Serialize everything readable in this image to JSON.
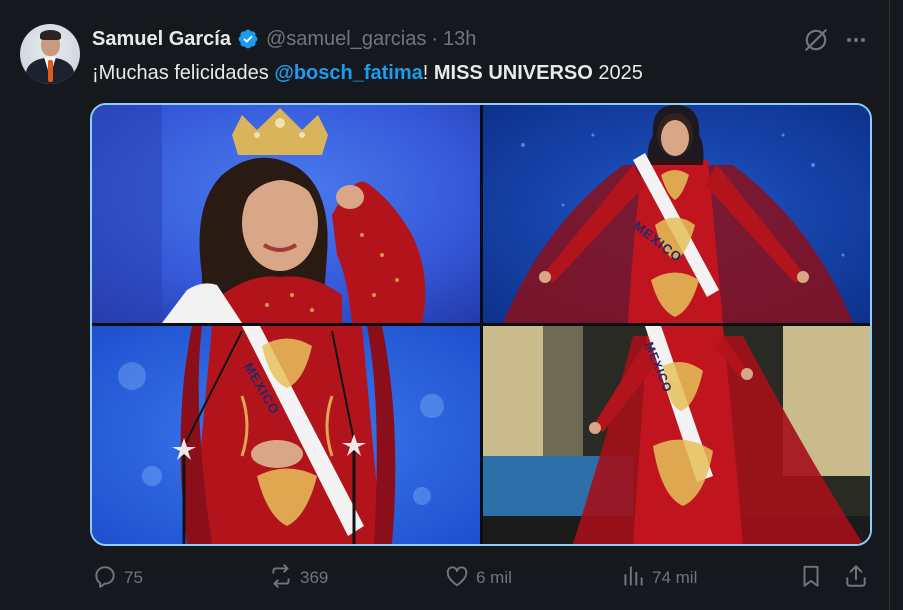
{
  "tweet": {
    "author_name": "Samuel García",
    "handle": "@samuel_garcias",
    "separator": "·",
    "time": "13h",
    "text_prefix": "¡Muchas felicidades ",
    "mention": "@bosch_fatima",
    "text_after_mention": "! ",
    "text_bold": "MISS UNIVERSO",
    "text_suffix": " 2025"
  },
  "media": {
    "sash_text": "MEXICO"
  },
  "actions": {
    "replies": "75",
    "reposts": "369",
    "likes": "6 mil",
    "views": "74 mil"
  },
  "icons": {
    "verified": "verified-badge-icon",
    "grok": "grok-icon",
    "more": "more-icon",
    "reply": "reply-icon",
    "repost": "repost-icon",
    "like": "like-icon",
    "views": "views-icon",
    "bookmark": "bookmark-icon",
    "share": "share-icon"
  },
  "colors": {
    "background": "#15181c",
    "text": "#e7e9ea",
    "muted": "#71767b",
    "accent": "#1d9bf0",
    "media_border": "#8ecdf8",
    "gown_red": "#b3141c"
  }
}
